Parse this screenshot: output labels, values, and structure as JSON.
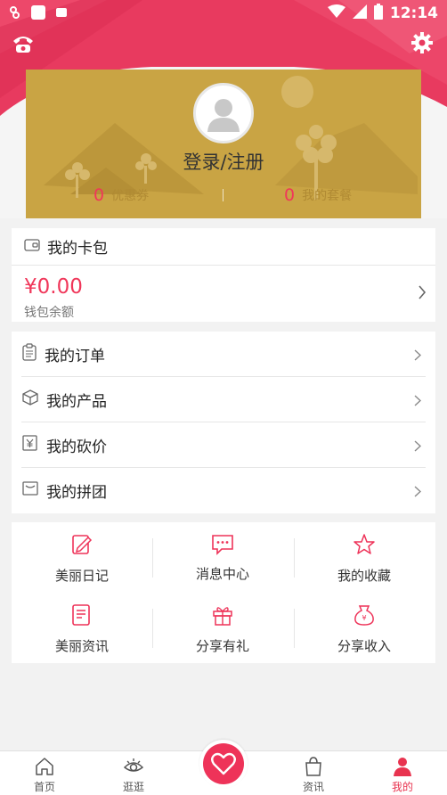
{
  "status_bar": {
    "time": "12:14"
  },
  "profile": {
    "login_label": "登录/注册",
    "coupons_count": "0",
    "coupons_label": "优惠券",
    "packages_count": "0",
    "packages_label": "我的套餐"
  },
  "wallet": {
    "title": "我的卡包",
    "amount": "¥0.00",
    "balance_label": "钱包余额"
  },
  "orders": {
    "items": [
      {
        "label": "我的订单",
        "icon": "clipboard-icon"
      },
      {
        "label": "我的产品",
        "icon": "box-icon"
      },
      {
        "label": "我的砍价",
        "icon": "yen-tag-icon"
      },
      {
        "label": "我的拼团",
        "icon": "envelope-icon"
      }
    ]
  },
  "features": {
    "items": [
      {
        "label": "美丽日记",
        "icon": "edit-note-icon"
      },
      {
        "label": "消息中心",
        "icon": "message-icon"
      },
      {
        "label": "我的收藏",
        "icon": "star-icon"
      },
      {
        "label": "美丽资讯",
        "icon": "news-icon"
      },
      {
        "label": "分享有礼",
        "icon": "gift-icon"
      },
      {
        "label": "分享收入",
        "icon": "money-bag-icon"
      }
    ]
  },
  "tabbar": {
    "tabs": [
      {
        "label": "首页",
        "icon": "home-icon"
      },
      {
        "label": "逛逛",
        "icon": "eye-icon"
      },
      {
        "label": "资讯",
        "icon": "bag-icon"
      },
      {
        "label": "我的",
        "icon": "person-icon"
      }
    ],
    "center_icon": "heart-icon",
    "active_tab": "我的"
  },
  "colors": {
    "accent": "#f0375a",
    "card_gold": "#c9a444"
  }
}
